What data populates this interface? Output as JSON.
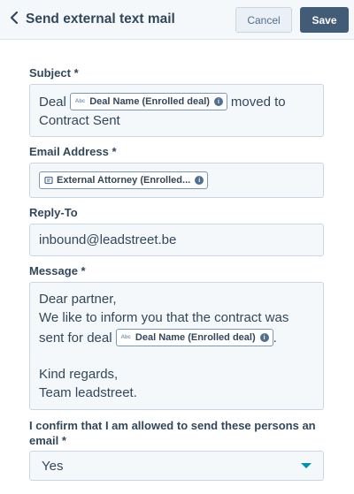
{
  "header": {
    "title": "Send external text mail",
    "cancel_label": "Cancel",
    "save_label": "Save"
  },
  "subject": {
    "label": "Subject *",
    "text_before": "Deal",
    "token_label": "Deal Name (Enrolled deal)",
    "text_after": "moved to",
    "line2": "Contract Sent"
  },
  "email_address": {
    "label": "Email Address *",
    "token_label": "External Attorney (Enrolled..."
  },
  "reply_to": {
    "label": "Reply-To",
    "value": "inbound@leadstreet.be"
  },
  "message": {
    "label": "Message *",
    "line1": "Dear partner,",
    "line2": "We like to inform you that the contract was",
    "line3_before": "sent for deal",
    "token_label": "Deal Name (Enrolled deal)",
    "line3_after": ".",
    "line5": "Kind regards,",
    "line6": "Team leadstreet."
  },
  "confirm": {
    "label_line1": "I confirm that I am allowed to send these persons an",
    "label_line2": "email *",
    "selected": "Yes"
  },
  "icons": {
    "back": "chevron-left-icon",
    "info": "info-icon",
    "text_property": "text-property-icon",
    "attorney_property": "contact-property-icon",
    "dropdown": "caret-down-icon"
  },
  "colors": {
    "header_bg": "#f5f8fa",
    "save_bg": "#425b76",
    "field_bg": "#f5f8fa",
    "caret": "#0091ae"
  }
}
